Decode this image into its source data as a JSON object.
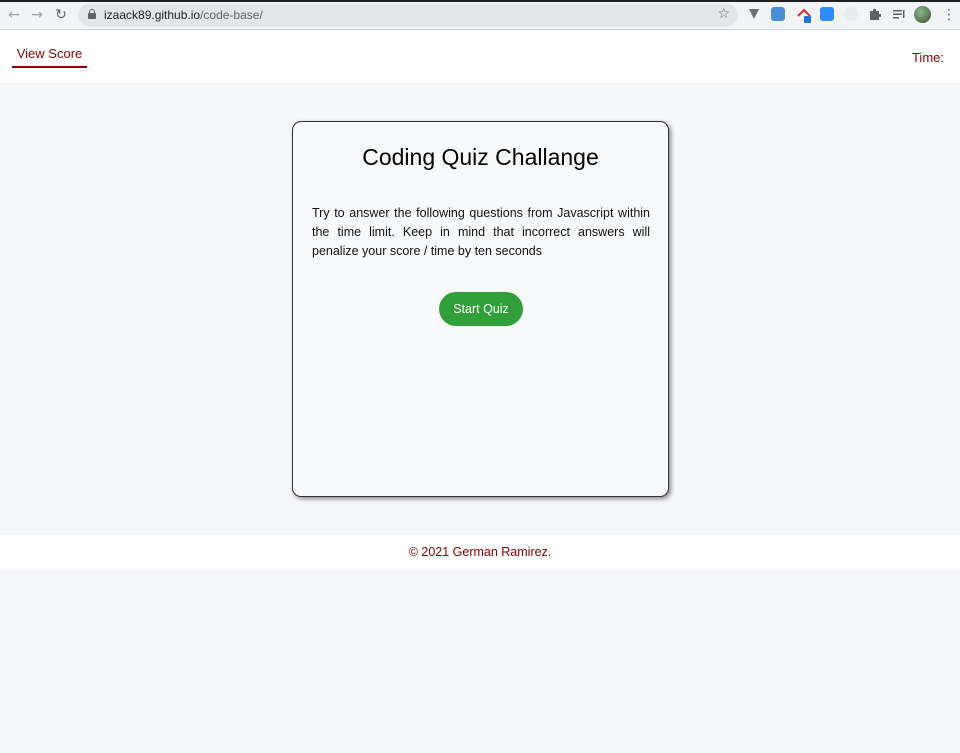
{
  "browser": {
    "url_host": "izaack89.github.io",
    "url_path": "/code-base/"
  },
  "icons": {
    "back": "back-arrow-icon",
    "forward": "forward-arrow-icon",
    "reload": "reload-icon",
    "lock": "lock-icon",
    "bookmark": "star-icon",
    "menu": "kebab-menu-icon"
  },
  "header": {
    "view_score_label": "View Score",
    "timer_label": "Time:"
  },
  "card": {
    "title": "Coding Quiz Challange",
    "description": "Try to answer the following questions from Javascript within the time limit. Keep in mind that incorrect answers will penalize your score / time by ten seconds",
    "start_button_label": "Start Quiz"
  },
  "footer": {
    "copyright": "© 2021 German Ramirez."
  },
  "colors": {
    "accent": "#8b0000",
    "button": "#31a03b",
    "page_background": "#f6f7fb"
  }
}
